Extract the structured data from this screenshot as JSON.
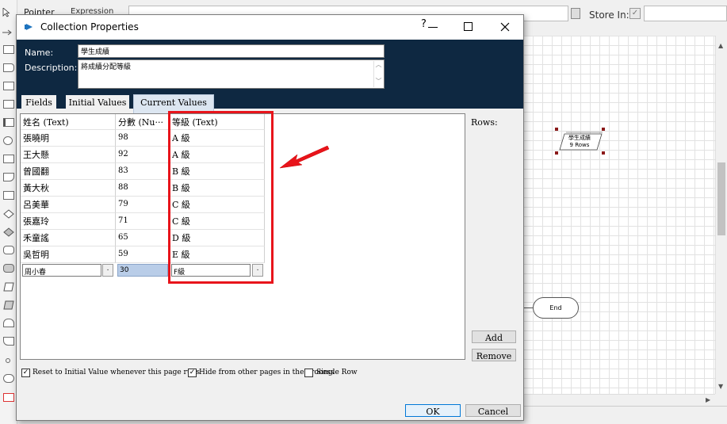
{
  "background": {
    "pointer_label": "Pointer",
    "expression_label": "Expression",
    "store_in_label": "Store In:",
    "canvas": {
      "collection_node_name": "學生成績",
      "collection_node_rows": "9 Rows",
      "end_node_label": "End"
    }
  },
  "dialog": {
    "title": "Collection Properties",
    "help_glyph": "?",
    "name_label": "Name:",
    "name_value": "學生成績",
    "description_label": "Description:",
    "description_value": "將成績分配等級",
    "tabs": [
      {
        "label": "Fields"
      },
      {
        "label": "Initial Values"
      },
      {
        "label": "Current Values"
      }
    ],
    "active_tab": "Current Values",
    "columns": [
      "姓名 (Text)",
      "分數 (Nu···",
      "等級 (Text)"
    ],
    "rows": [
      {
        "name": "張曉明",
        "score": "98",
        "grade": "A 級"
      },
      {
        "name": "王大懸",
        "score": "92",
        "grade": "A 級"
      },
      {
        "name": "曾國翻",
        "score": "83",
        "grade": "B 級"
      },
      {
        "name": "黃大秋",
        "score": "88",
        "grade": "B 級"
      },
      {
        "name": "呂美華",
        "score": "79",
        "grade": "C 級"
      },
      {
        "name": "張嘉玲",
        "score": "71",
        "grade": "C 級"
      },
      {
        "name": "禾童謠",
        "score": "65",
        "grade": "D 級"
      },
      {
        "name": "吳哲明",
        "score": "59",
        "grade": "E 級"
      }
    ],
    "edit_row": {
      "name": "周小春",
      "score": "30",
      "grade": "F級",
      "ellipsis": "."
    },
    "rows_label": "Rows:",
    "add_button": "Add",
    "remove_button": "Remove",
    "options": [
      {
        "label": "Reset to Initial Value whenever this page runs",
        "checked": true
      },
      {
        "label": "Hide from other pages in the process",
        "checked": true
      },
      {
        "label": "Single Row",
        "checked": false
      }
    ],
    "ok_button": "OK",
    "cancel_button": "Cancel"
  },
  "colors": {
    "header_bg": "#0e2841",
    "highlight_box": "#e8141b",
    "arrow": "#e8141b",
    "selection": "#b9cde8"
  }
}
